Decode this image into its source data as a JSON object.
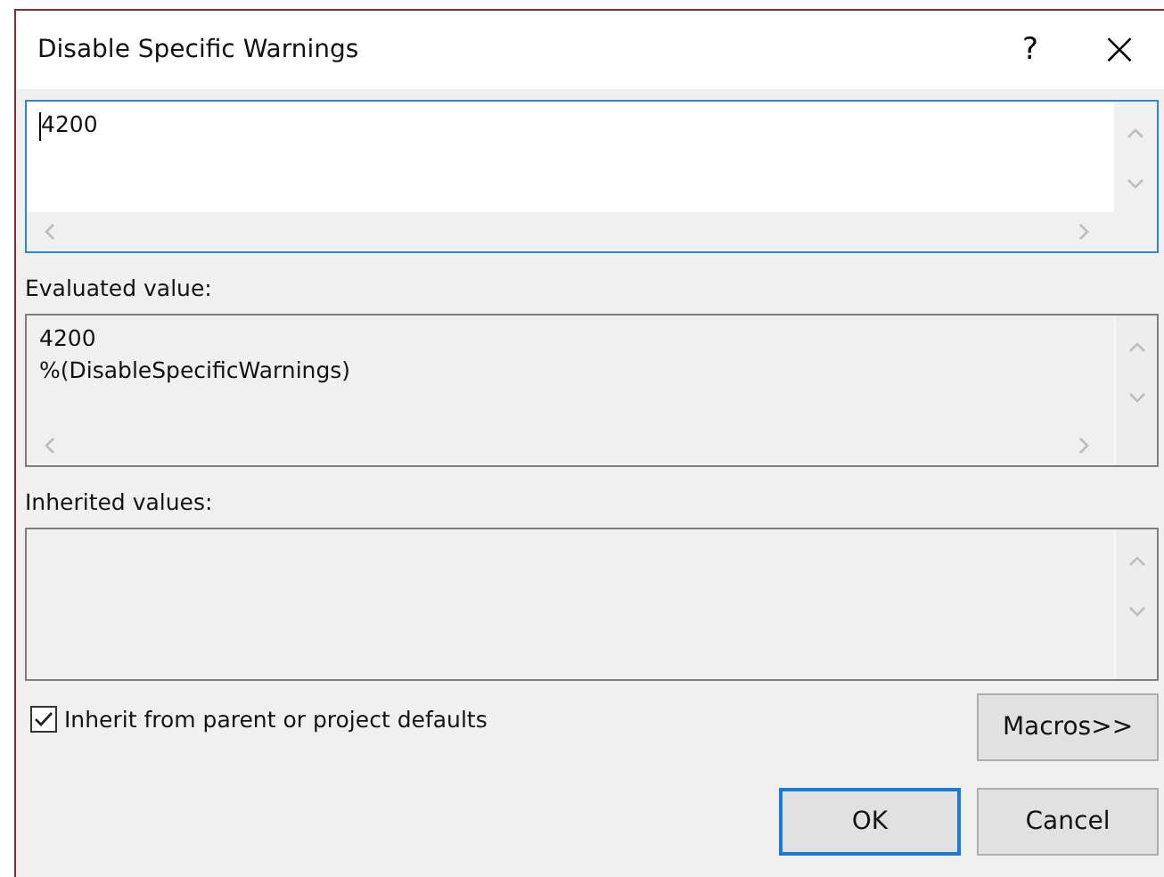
{
  "window": {
    "title": "Disable Specific Warnings",
    "help": "?",
    "close": "×"
  },
  "editor": {
    "value": "4200"
  },
  "sections": [
    {
      "label": "Evaluated value:",
      "lines": [
        "4200",
        "%(DisableSpecificWarnings)"
      ],
      "horizontal_scroll": true
    },
    {
      "label": "Inherited values:",
      "horizontal_scroll": false
    }
  ],
  "inherit": {
    "label": "Inherit from parent or project defaults",
    "checked": true
  },
  "buttons": [
    {
      "label": "Macros>>",
      "kind": "macros"
    },
    {
      "label": "OK",
      "kind": "default"
    },
    {
      "label": "Cancel",
      "kind": "normal"
    }
  ]
}
